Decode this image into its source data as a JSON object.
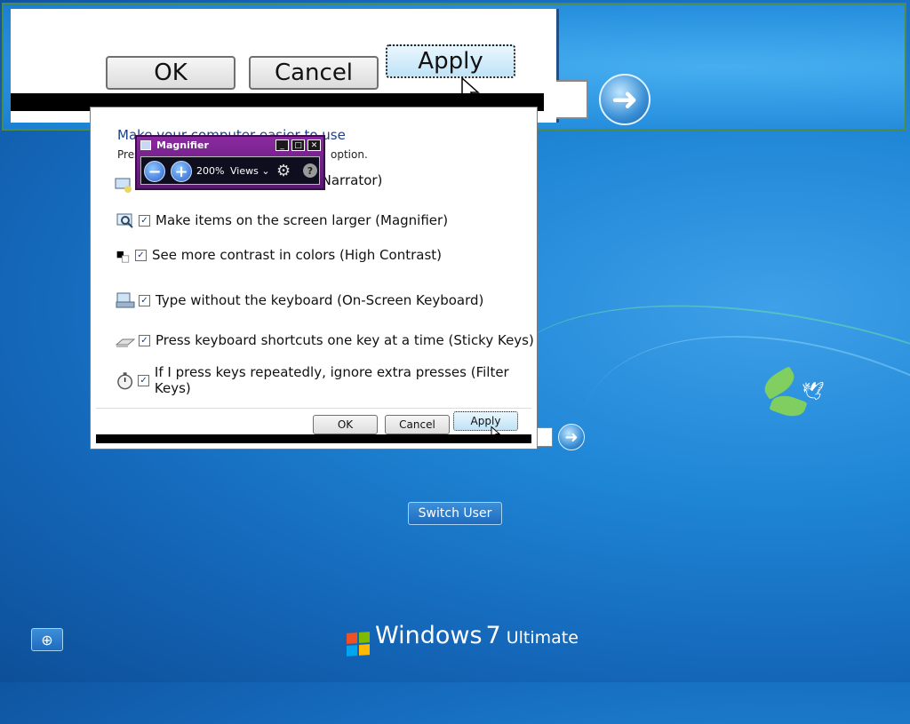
{
  "zoom_view": {
    "ok_label": "OK",
    "cancel_label": "Cancel",
    "apply_label": "Apply"
  },
  "ease_dialog": {
    "heading": "Make your computer easier to use",
    "instruction_start": "Press",
    "instruction_end": "option.",
    "options": [
      {
        "label": "Hear text on the screen read aloud (Narrator)",
        "visible_label": "ud (Narrator)",
        "checked": true,
        "icon": "narrator-icon"
      },
      {
        "label": "Make items on the screen larger (Magnifier)",
        "checked": true,
        "icon": "magnifier-icon"
      },
      {
        "label": "See more contrast in colors (High Contrast)",
        "checked": true,
        "icon": "high-contrast-icon"
      },
      {
        "label": "Type without the keyboard (On-Screen Keyboard)",
        "checked": true,
        "icon": "keyboard-icon"
      },
      {
        "label": "Press keyboard shortcuts one key at a time (Sticky Keys)",
        "checked": true,
        "icon": "sticky-keys-icon"
      },
      {
        "label": "If I press keys repeatedly, ignore extra presses (Filter Keys)",
        "checked": true,
        "icon": "stopwatch-icon"
      }
    ],
    "ok_label": "OK",
    "cancel_label": "Cancel",
    "apply_label": "Apply"
  },
  "magnifier": {
    "title": "Magnifier",
    "zoom_level": "200%",
    "views_label": "Views",
    "minimize": "_",
    "maximize": "□",
    "close": "✕"
  },
  "login": {
    "switch_user_label": "Switch User"
  },
  "branding": {
    "windows": "Windows",
    "version": "7",
    "edition": "Ultimate"
  },
  "colors": {
    "desktop": "#1466b8",
    "magnifier_frame": "#8a2aa0",
    "dialog_heading": "#1e3f8a"
  }
}
